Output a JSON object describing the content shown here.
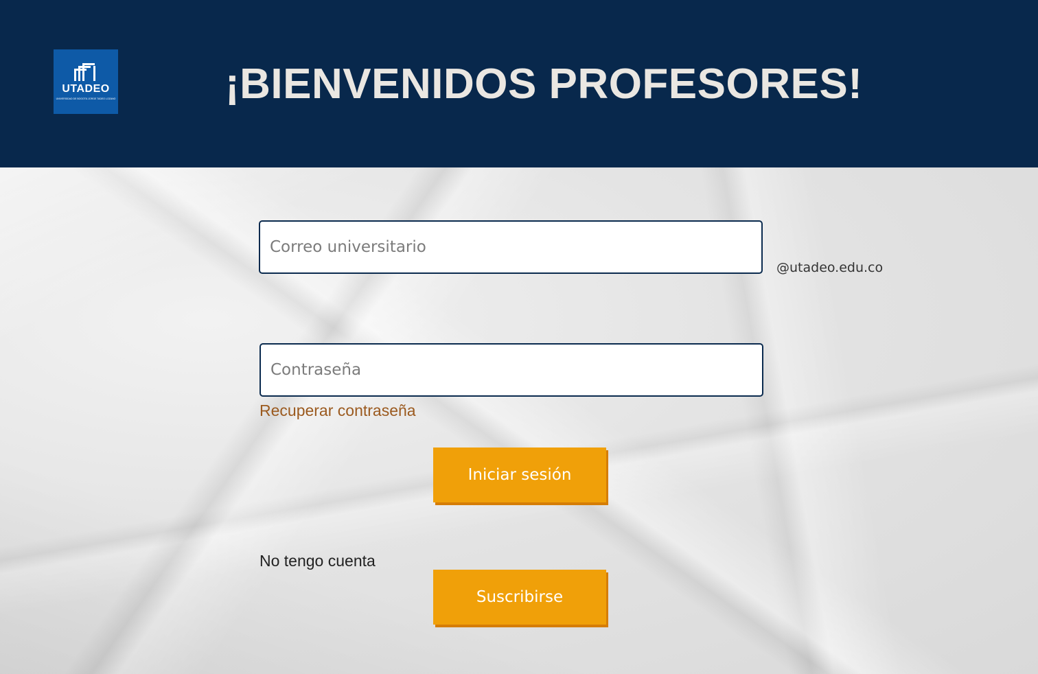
{
  "header": {
    "title": "¡BIENVENIDOS PROFESORES!",
    "logo": {
      "text": "UTADEO",
      "subtext": "UNIVERSIDAD DE BOGOTÁ JORGE TADEO LOZANO",
      "icon": "utadeo-logo-icon"
    }
  },
  "form": {
    "email_placeholder": "Correo universitario",
    "email_value": "",
    "email_domain": "@utadeo.edu.co",
    "password_placeholder": "Contraseña",
    "password_value": "",
    "recover_link": "Recuperar contraseña",
    "login_button": "Iniciar sesión",
    "no_account_text": "No tengo cuenta",
    "subscribe_button": "Suscribirse"
  },
  "colors": {
    "header_bg": "#08284c",
    "logo_bg": "#0e5aa7",
    "title": "#eae7e2",
    "button": "#f0a009",
    "link": "#9b5a1f",
    "field_border": "#0a2a4e"
  }
}
